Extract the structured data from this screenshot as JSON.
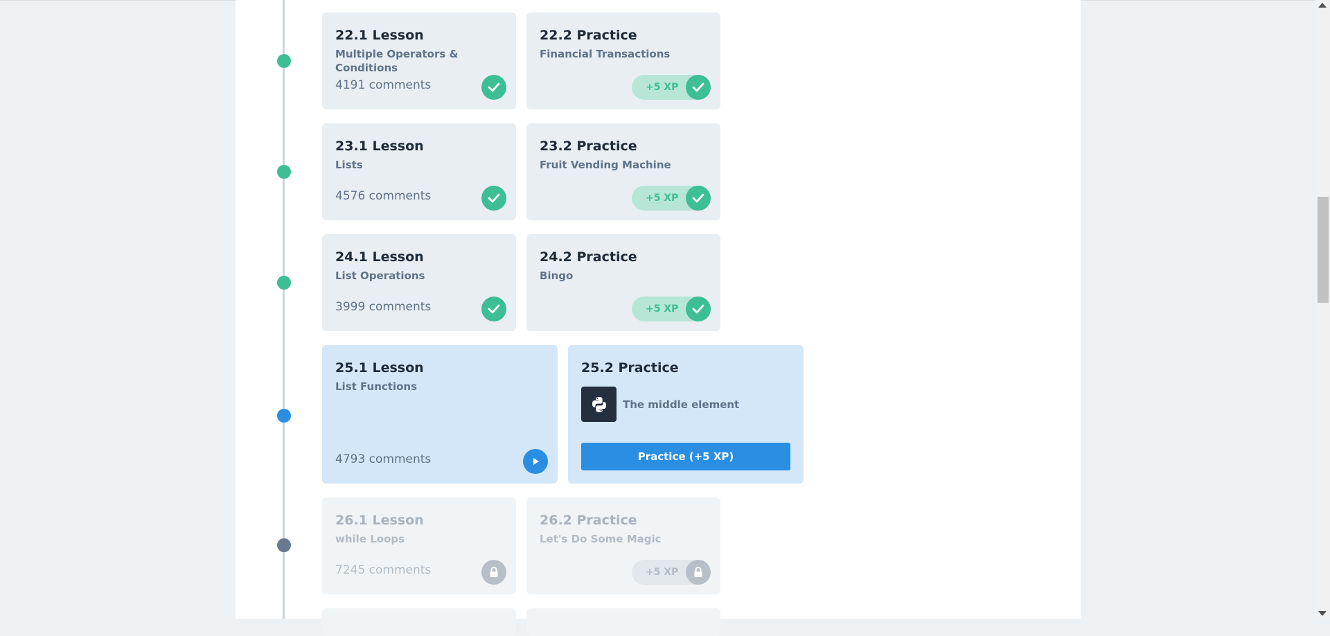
{
  "colors": {
    "done": "#3dbe94",
    "current": "#2a8ee3",
    "locked": "#687a8f",
    "card_done_bg": "#e9eef2",
    "card_current_bg": "#d3e7f8",
    "card_locked_bg": "#f1f4f6"
  },
  "icons": {
    "done": "check-icon",
    "current": "play-icon",
    "locked": "lock-icon",
    "language": "python-logo-icon"
  },
  "units": [
    {
      "status": "done",
      "lesson": {
        "number": "22.1 Lesson",
        "title": "Multiple Operators & Conditions",
        "comments": "4191 comments"
      },
      "practice": {
        "number": "22.2 Practice",
        "title": "Financial Transactions",
        "xp": "+5 XP"
      }
    },
    {
      "status": "done",
      "lesson": {
        "number": "23.1 Lesson",
        "title": "Lists",
        "comments": "4576 comments"
      },
      "practice": {
        "number": "23.2 Practice",
        "title": "Fruit Vending Machine",
        "xp": "+5 XP"
      }
    },
    {
      "status": "done",
      "lesson": {
        "number": "24.1 Lesson",
        "title": "List Operations",
        "comments": "3999 comments"
      },
      "practice": {
        "number": "24.2 Practice",
        "title": "Bingo",
        "xp": "+5 XP"
      }
    },
    {
      "status": "current",
      "lesson": {
        "number": "25.1 Lesson",
        "title": "List Functions",
        "comments": "4793 comments"
      },
      "practice": {
        "number": "25.2 Practice",
        "exercise": "The middle element",
        "button": "Practice (+5 XP)"
      }
    },
    {
      "status": "locked",
      "lesson": {
        "number": "26.1 Lesson",
        "title": "while Loops",
        "comments": "7245 comments"
      },
      "practice": {
        "number": "26.2 Practice",
        "title": "Let's Do Some Magic",
        "xp": "+5 XP"
      }
    }
  ]
}
